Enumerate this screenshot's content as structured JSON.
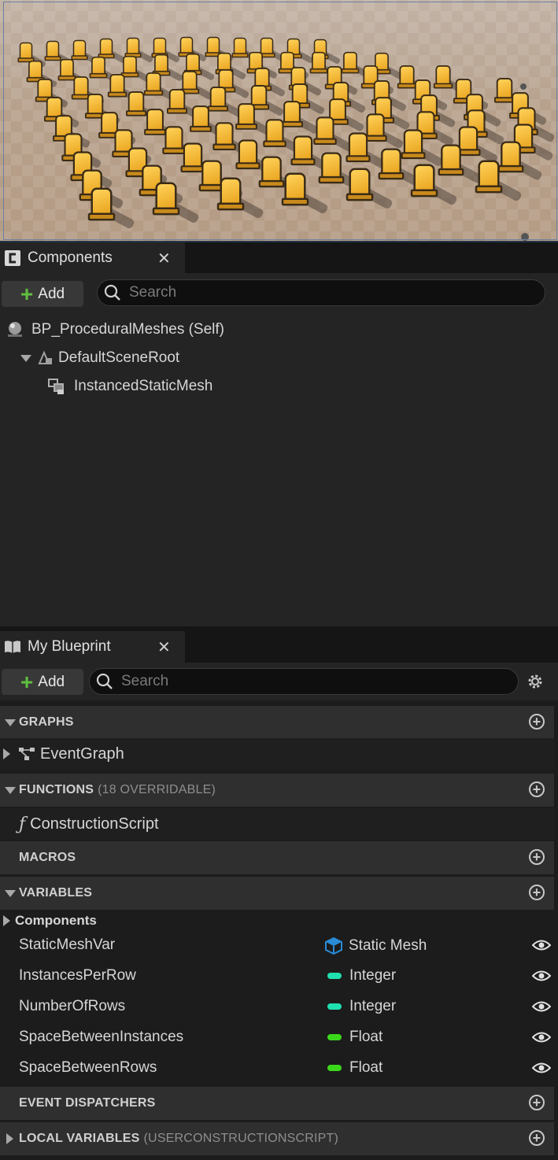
{
  "components_panel": {
    "tab_title": "Components",
    "add_label": "Add",
    "search_placeholder": "Search",
    "tree": [
      {
        "label": "BP_ProceduralMeshes (Self)",
        "icon": "actor-sphere-icon"
      },
      {
        "label": "DefaultSceneRoot",
        "icon": "scene-root-icon"
      },
      {
        "label": "InstancedStaticMesh",
        "icon": "instanced-mesh-icon"
      }
    ]
  },
  "my_blueprint": {
    "tab_title": "My Blueprint",
    "add_label": "Add",
    "search_placeholder": "Search",
    "sections": {
      "graphs": "GRAPHS",
      "functions": "FUNCTIONS",
      "functions_sub": "(18 OVERRIDABLE)",
      "macros": "MACROS",
      "variables": "VARIABLES",
      "event_dispatchers": "EVENT DISPATCHERS",
      "local_variables": "LOCAL VARIABLES",
      "local_variables_sub": "(USERCONSTRUCTIONSCRIPT)"
    },
    "graphs_items": [
      {
        "label": "EventGraph"
      }
    ],
    "functions_items": [
      {
        "label": "ConstructionScript"
      }
    ],
    "variables_category": "Components",
    "variables": [
      {
        "name": "StaticMeshVar",
        "type": "Static Mesh",
        "color": "#2a8bd6"
      },
      {
        "name": "InstancesPerRow",
        "type": "Integer",
        "color": "#1fe0b0"
      },
      {
        "name": "NumberOfRows",
        "type": "Integer",
        "color": "#1fe0b0"
      },
      {
        "name": "SpaceBetweenInstances",
        "type": "Float",
        "color": "#3ad81a"
      },
      {
        "name": "SpaceBetweenRows",
        "type": "Float",
        "color": "#3ad81a"
      }
    ]
  }
}
